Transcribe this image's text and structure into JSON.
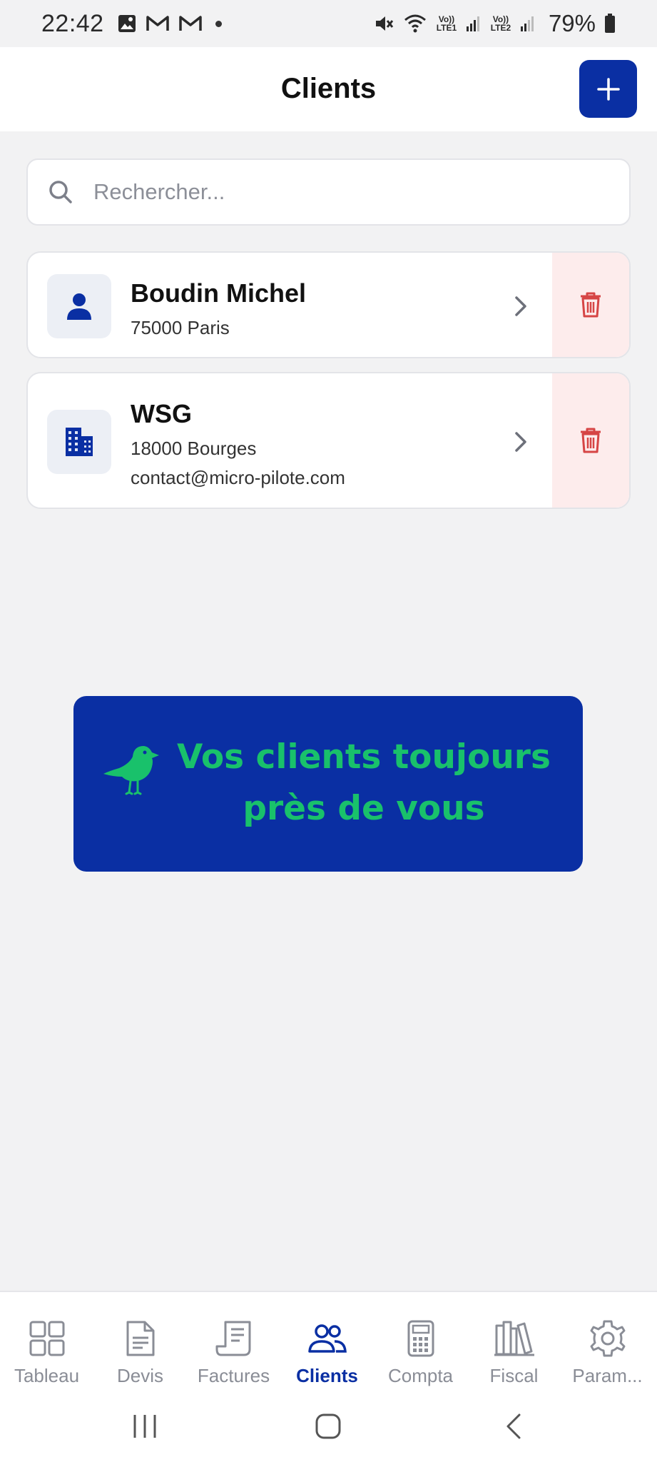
{
  "status_bar": {
    "time": "22:42",
    "volte1": "Vo)) LTE1",
    "volte2": "Vo)) LTE2",
    "battery": "79%"
  },
  "header": {
    "title": "Clients",
    "add_icon": "plus-icon"
  },
  "search": {
    "placeholder": "Rechercher..."
  },
  "clients": [
    {
      "name": "Boudin Michel",
      "address": "75000 Paris",
      "email": "",
      "icon": "person-icon"
    },
    {
      "name": "WSG",
      "address": "18000 Bourges",
      "email": "contact@micro-pilote.com",
      "icon": "building-icon"
    }
  ],
  "promo": {
    "line1": "Vos clients toujours",
    "line2": "près de vous",
    "icon": "bird-icon"
  },
  "bottom_nav": {
    "items": [
      {
        "label": "Tableau",
        "icon": "dashboard-icon",
        "active": false
      },
      {
        "label": "Devis",
        "icon": "document-icon",
        "active": false
      },
      {
        "label": "Factures",
        "icon": "invoice-icon",
        "active": false
      },
      {
        "label": "Clients",
        "icon": "users-icon",
        "active": true
      },
      {
        "label": "Compta",
        "icon": "calculator-icon",
        "active": false
      },
      {
        "label": "Fiscal",
        "icon": "library-icon",
        "active": false
      },
      {
        "label": "Param...",
        "icon": "gear-icon",
        "active": false
      }
    ]
  },
  "colors": {
    "brand": "#0a2fa3",
    "promo_text": "#19c16b",
    "delete": "#d64545",
    "delete_bg": "#fdecec",
    "background": "#f2f2f3"
  }
}
